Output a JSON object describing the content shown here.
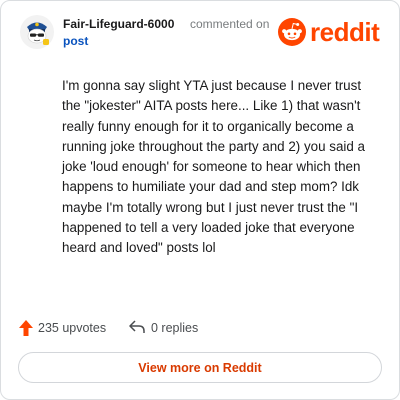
{
  "header": {
    "author": "Fair-Lifeguard-6000",
    "action": "commented on",
    "post_link": "post",
    "brand": "reddit"
  },
  "comment": {
    "body": "I'm gonna say slight YTA just because I never trust the \"jokester\" AITA posts here... Like 1) that wasn't really funny enough for it to organically become a running joke throughout the party and 2) you said a joke 'loud enough' for someone to hear which then happens to humiliate your dad and step mom? Idk maybe I'm totally wrong but I just never trust the \"I happened to tell a very loaded joke that everyone heard and loved\" posts lol"
  },
  "footer": {
    "upvotes": "235 upvotes",
    "replies": "0 replies"
  },
  "cta": {
    "label": "View more on Reddit"
  },
  "colors": {
    "brand": "#ff4500",
    "link": "#0a53be",
    "cta_text": "#d93a00"
  },
  "icons": [
    "avatar-snoo",
    "reddit-logo-icon",
    "upvote-arrow-icon",
    "reply-arrow-icon"
  ]
}
